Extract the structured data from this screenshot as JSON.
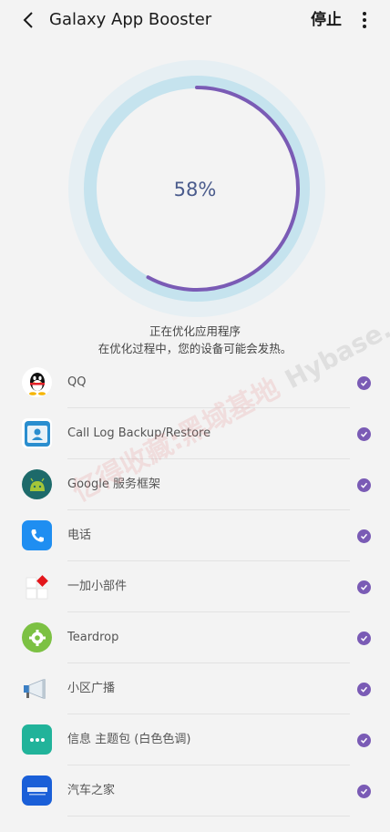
{
  "header": {
    "title": "Galaxy App Booster",
    "stop_label": "停止"
  },
  "progress": {
    "percent_label": "58%",
    "value": 0.58,
    "status_line1": "正在优化应用程序",
    "status_line2": "在优化过程中，您的设备可能会发热。"
  },
  "apps": [
    {
      "name": "QQ",
      "icon": "qq-penguin-icon",
      "checked": true
    },
    {
      "name": "Call Log Backup/Restore",
      "icon": "call-log-backup-icon",
      "checked": true
    },
    {
      "name": "Google 服务框架",
      "icon": "android-robot-icon",
      "checked": true
    },
    {
      "name": "电话",
      "icon": "phone-icon",
      "checked": true
    },
    {
      "name": "一加小部件",
      "icon": "oneplus-widget-icon",
      "checked": true
    },
    {
      "name": "Teardrop",
      "icon": "gear-icon",
      "checked": true
    },
    {
      "name": "小区广播",
      "icon": "megaphone-icon",
      "checked": true
    },
    {
      "name": "信息 主题包 (白色色调)",
      "icon": "messages-icon",
      "checked": true
    },
    {
      "name": "汽车之家",
      "icon": "autohome-icon",
      "checked": true
    }
  ],
  "watermark": {
    "text": "亿得收藏:黑域基地",
    "text2": "Hybase.com"
  },
  "colors": {
    "accent": "#7a5bb5",
    "ring_track": "#b9dde9",
    "ring_outer": "#e4eef2",
    "percent_text": "#4a5b8c"
  }
}
